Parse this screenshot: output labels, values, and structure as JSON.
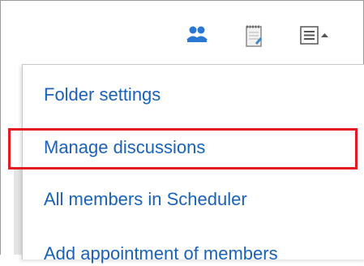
{
  "toolbar": {
    "members_icon": "members-icon",
    "notes_icon": "notepad-icon",
    "menu_icon": "menu-list-icon",
    "accent_color": "#2a78d4"
  },
  "menu": {
    "items": [
      {
        "label": "Folder settings"
      },
      {
        "label": "Manage discussions",
        "highlighted": true
      },
      {
        "label": "All members in Scheduler"
      },
      {
        "label": "Add appointment of members"
      }
    ],
    "link_color": "#1a62b8",
    "highlight_color": "#e11b22"
  }
}
